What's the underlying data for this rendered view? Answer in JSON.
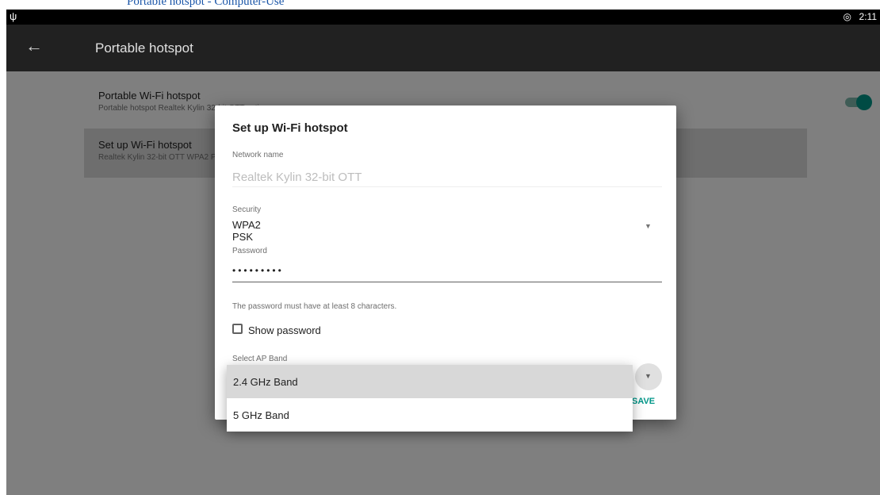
{
  "browser_link": "Portable hotspot - Computer-Use",
  "status_bar": {
    "usb_icon": "usb-icon",
    "wifi_icon": "wifi-hotspot-icon",
    "time": "2:11"
  },
  "appbar": {
    "title": "Portable hotspot",
    "back_icon": "back-arrow-icon"
  },
  "prefs": [
    {
      "title": "Portable Wi-Fi hotspot",
      "summary": "Portable hotspot Realtek Kylin 32-bit OTT active",
      "toggle_on": true
    },
    {
      "title": "Set up Wi-Fi hotspot",
      "summary": "Realtek Kylin 32-bit OTT WPA2 PSK portable Wi-Fi hotspot"
    }
  ],
  "dialog": {
    "title": "Set up Wi-Fi hotspot",
    "network_name_label": "Network name",
    "network_name_value": "Realtek Kylin 32-bit OTT",
    "security_label": "Security",
    "security_value": "WPA2 PSK",
    "password_label": "Password",
    "password_value": "•••••••••",
    "password_hint": "The password must have at least 8 characters.",
    "show_password_label": "Show password",
    "show_password_checked": false,
    "ap_band_label": "Select AP Band",
    "save_label": "SAVE"
  },
  "band_options": [
    {
      "label": "2.4 GHz Band",
      "selected": true
    },
    {
      "label": "5 GHz Band",
      "selected": false
    }
  ],
  "colors": {
    "accent": "#009688",
    "appbar": "#212121",
    "scrim": "rgba(0,0,0,0.5)"
  }
}
